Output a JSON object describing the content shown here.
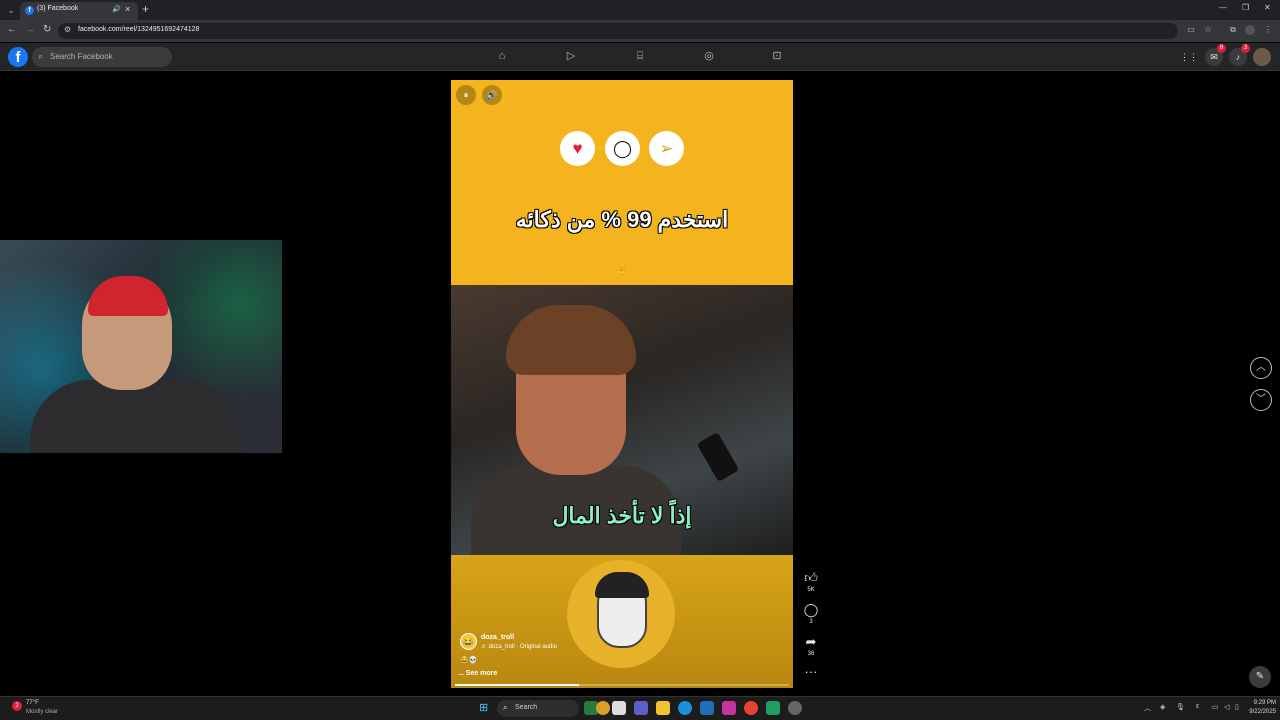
{
  "browser": {
    "tab_title": "(3) Facebook",
    "url": "facebook.com/reel/1324951692474128",
    "tab_close": "×",
    "new_tab": "+"
  },
  "facebook": {
    "logo": "f",
    "search_placeholder": "Search Facebook",
    "nav_icons": [
      "home-icon",
      "video-icon",
      "marketplace-icon",
      "groups-icon",
      "gaming-icon"
    ],
    "messenger_badge": "8",
    "notifications_badge": "3"
  },
  "reel": {
    "headline": "استخدم 99 % من ذكائه",
    "subtitle": "إذاً لا تأخذ المال",
    "username": "doza_troll",
    "audio": "♬ doza_troll · Original audio",
    "emoji": "😂💀",
    "see_more": "... See more",
    "progress": 0.37,
    "likes": "5K",
    "comments": "3",
    "shares": "36",
    "more": "···"
  },
  "taskbar": {
    "weather_temp": "77°F",
    "weather_desc": "Mostly clear",
    "weather_badge": "2",
    "search_label": "Search",
    "time": "9:29 PM",
    "date": "9/22/2025"
  }
}
